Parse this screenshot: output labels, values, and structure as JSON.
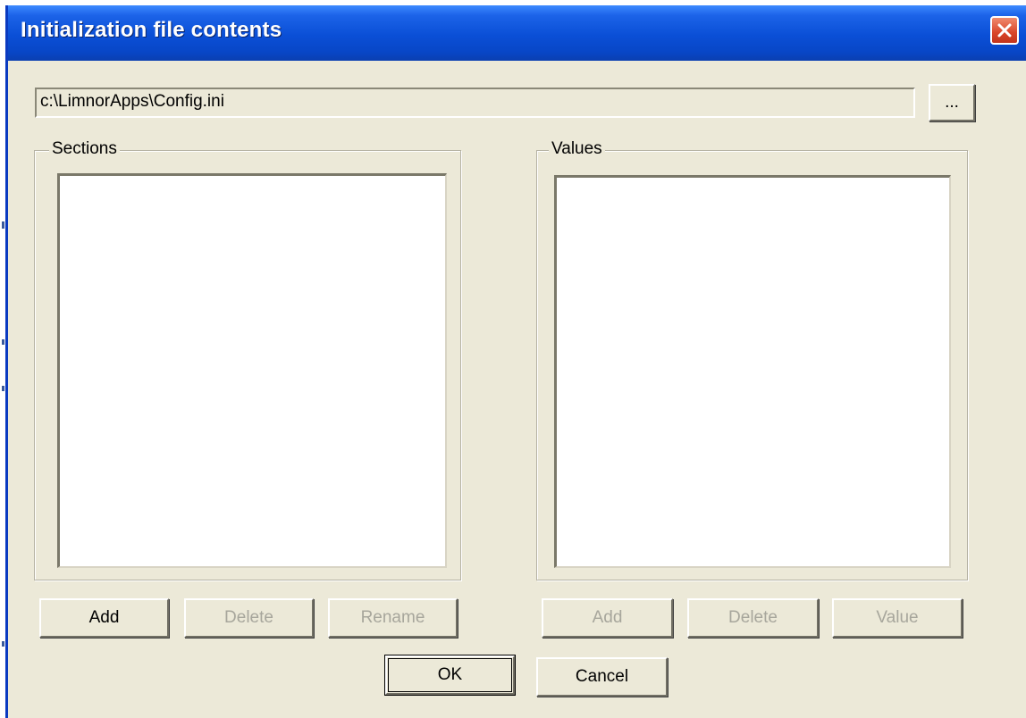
{
  "window": {
    "title": "Initialization file contents",
    "close_icon": "close-icon"
  },
  "file": {
    "path": "c:\\LimnorApps\\Config.ini",
    "browse_label": "..."
  },
  "sections": {
    "label": "Sections",
    "items": [],
    "add_label": "Add",
    "delete_label": "Delete",
    "rename_label": "Rename"
  },
  "values": {
    "label": "Values",
    "items": [],
    "add_label": "Add",
    "delete_label": "Delete",
    "value_label": "Value"
  },
  "dialog": {
    "ok_label": "OK",
    "cancel_label": "Cancel"
  },
  "colors": {
    "titlebar": "#0a4fd6",
    "dialog_bg": "#ece9d8",
    "disabled_text": "#a7a69c",
    "close_red": "#d9462a"
  }
}
